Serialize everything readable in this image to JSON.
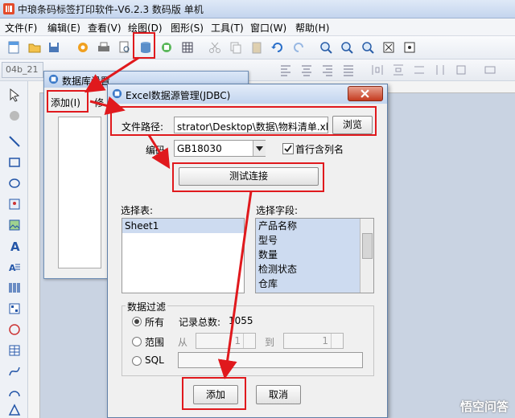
{
  "app": {
    "title": "中琅条码标签打印软件-V6.2.3 数码版 单机",
    "doc_tab": "04b_21"
  },
  "menu": [
    "文件(F)",
    "编辑(E)",
    "查看(V)",
    "绘图(D)",
    "图形(S)",
    "工具(T)",
    "窗口(W)",
    "帮助(H)"
  ],
  "db_dialog": {
    "title": "数据库设置",
    "add_label": "添加(I)",
    "edit_label": "修"
  },
  "excel_dialog": {
    "title": "Excel数据源管理(JDBC)",
    "file_path_label": "文件路径:",
    "file_path_value": "strator\\Desktop\\数据\\物料清单.xlsx",
    "browse_label": "浏览",
    "encoding_label": "编码:",
    "encoding_value": "GB18030",
    "first_row_label": "首行含列名",
    "first_row_checked": true,
    "test_connection_label": "测试连接",
    "select_table_label": "选择表:",
    "tables": [
      "Sheet1"
    ],
    "select_field_label": "选择字段:",
    "fields": [
      "产品名称",
      "型号",
      "数量",
      "检测状态",
      "仓库"
    ],
    "filter": {
      "group_label": "数据过滤",
      "all_label": "所有",
      "total_label": "记录总数:",
      "total_value": "1055",
      "range_label": "范围",
      "from_label": "从",
      "from_value": "1",
      "to_label": "到",
      "to_value": "1",
      "sql_label": "SQL"
    },
    "add_button": "添加",
    "cancel_button": "取消"
  },
  "watermark": "悟空问答",
  "colors": {
    "highlight_red": "#e0191d",
    "selection_blue": "#cddbf0",
    "titlebar": "#c4d5ee"
  }
}
